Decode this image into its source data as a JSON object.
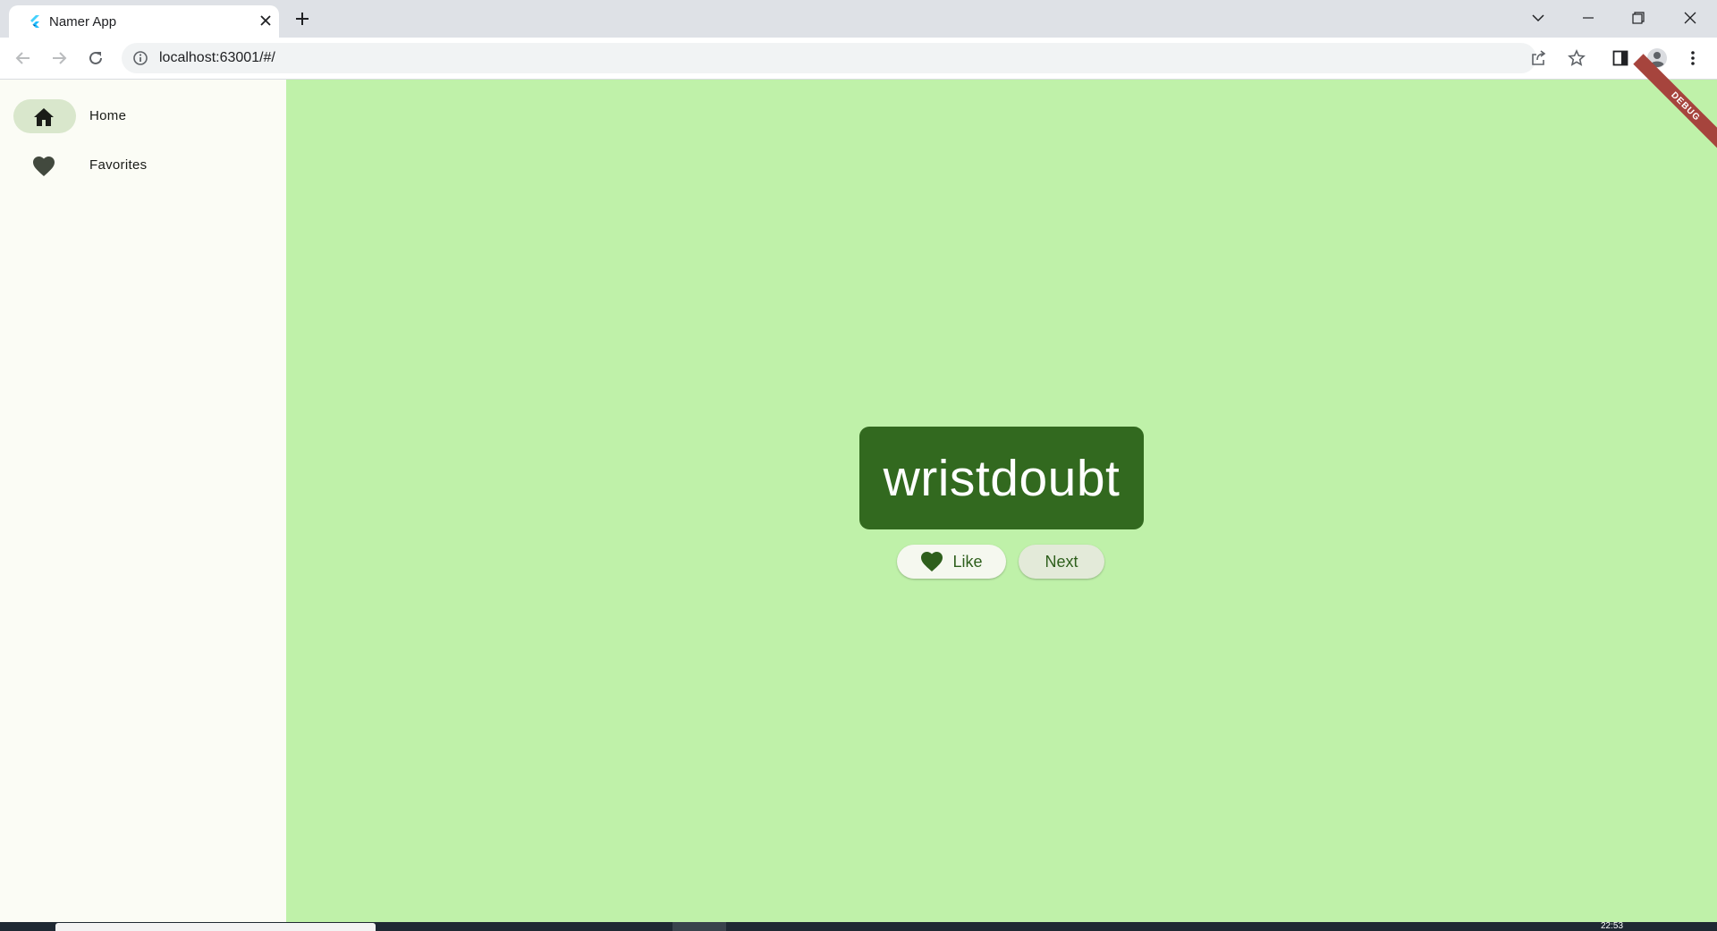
{
  "browser": {
    "tab": {
      "title": "Namer App",
      "favicon": "flutter-logo-icon"
    },
    "address_bar": {
      "url": "localhost:63001/#/"
    },
    "icons": {
      "back": "arrow-left-icon",
      "forward": "arrow-right-icon",
      "reload": "reload-icon",
      "share": "share-icon",
      "bookmark": "star-icon",
      "side_panel": "side-panel-icon",
      "profile": "profile-icon",
      "menu": "kebab-menu-icon"
    }
  },
  "app": {
    "nav": [
      {
        "label": "Home",
        "icon": "home-icon",
        "selected": true
      },
      {
        "label": "Favorites",
        "icon": "heart-icon",
        "selected": false
      }
    ],
    "current_pair": "wristdoubt",
    "buttons": {
      "like": "Like",
      "next": "Next"
    },
    "debug_banner": "DEBUG",
    "colors": {
      "background": "#bff1a9",
      "card": "#32691f",
      "rail": "#fbfcf5",
      "nav_indicator": "#d9e7cc",
      "accent_text": "#2e5f1c",
      "debug_banner": "#a6443d"
    }
  },
  "taskbar": {
    "clock": "22:53"
  }
}
